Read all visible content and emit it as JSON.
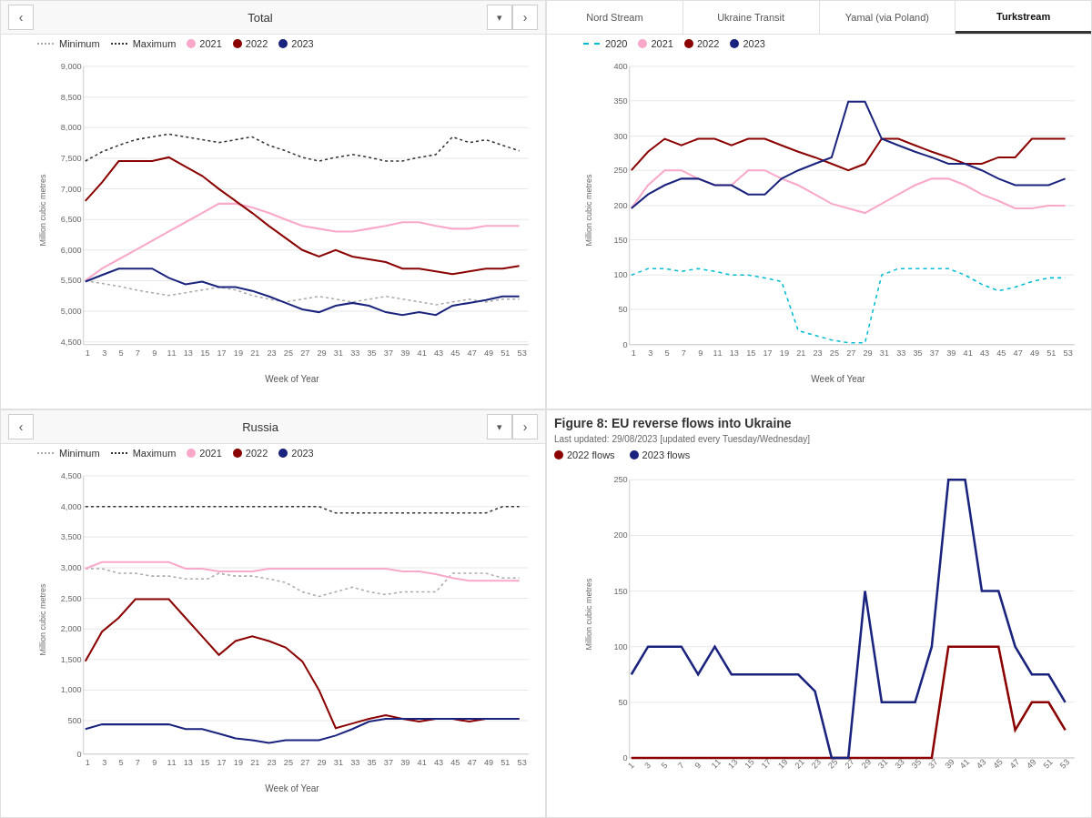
{
  "panels": {
    "top_left": {
      "title": "Total",
      "nav_prev": "‹",
      "nav_next": "›",
      "dropdown": "▾",
      "legend": [
        {
          "label": "Minimum",
          "color": "#aaa",
          "type": "dot-dashed"
        },
        {
          "label": "Maximum",
          "color": "#333",
          "type": "dot-dashed"
        },
        {
          "label": "2021",
          "color": "#f9a8c9",
          "type": "dot"
        },
        {
          "label": "2022",
          "color": "#8b0000",
          "type": "dot"
        },
        {
          "label": "2023",
          "color": "#1a237e",
          "type": "dot"
        }
      ],
      "y_label": "Million cubic metres",
      "x_label": "Week of Year",
      "y_ticks": [
        "9,000",
        "8,500",
        "8,000",
        "7,500",
        "7,000",
        "6,500",
        "6,000",
        "5,500",
        "5,000",
        "4,500"
      ],
      "x_ticks": [
        "1",
        "3",
        "5",
        "7",
        "9",
        "11",
        "13",
        "15",
        "17",
        "19",
        "21",
        "23",
        "25",
        "27",
        "29",
        "31",
        "33",
        "35",
        "37",
        "39",
        "41",
        "43",
        "45",
        "47",
        "49",
        "51",
        "53"
      ]
    },
    "top_right": {
      "tabs": [
        "Nord Stream",
        "Ukraine Transit",
        "Yamal (via Poland)",
        "Turkstream"
      ],
      "active_tab": "Turkstream",
      "legend": [
        {
          "label": "2020",
          "color": "#00bcd4",
          "type": "dot-dashed"
        },
        {
          "label": "2021",
          "color": "#f9a8c9",
          "type": "dot"
        },
        {
          "label": "2022",
          "color": "#8b0000",
          "type": "dot"
        },
        {
          "label": "2023",
          "color": "#1a237e",
          "type": "dot"
        }
      ],
      "y_label": "Million cubic metres",
      "x_label": "Week of Year",
      "y_ticks": [
        "400",
        "350",
        "300",
        "250",
        "200",
        "150",
        "100",
        "50",
        "0"
      ],
      "x_ticks": [
        "1",
        "3",
        "5",
        "7",
        "9",
        "11",
        "13",
        "15",
        "17",
        "19",
        "21",
        "23",
        "25",
        "27",
        "29",
        "31",
        "33",
        "35",
        "37",
        "39",
        "41",
        "43",
        "45",
        "47",
        "49",
        "51",
        "53"
      ]
    },
    "bottom_left": {
      "title": "Russia",
      "nav_prev": "‹",
      "nav_next": "›",
      "dropdown": "▾",
      "legend": [
        {
          "label": "Minimum",
          "color": "#aaa",
          "type": "dot-dashed"
        },
        {
          "label": "Maximum",
          "color": "#333",
          "type": "dot-dashed"
        },
        {
          "label": "2021",
          "color": "#f9a8c9",
          "type": "dot"
        },
        {
          "label": "2022",
          "color": "#8b0000",
          "type": "dot"
        },
        {
          "label": "2023",
          "color": "#1a237e",
          "type": "dot"
        }
      ],
      "y_label": "Million cubic metres",
      "x_label": "Week of Year",
      "y_ticks": [
        "4,500",
        "4,000",
        "3,500",
        "3,000",
        "2,500",
        "2,000",
        "1,500",
        "1,000",
        "500",
        "0"
      ],
      "x_ticks": [
        "1",
        "3",
        "5",
        "7",
        "9",
        "11",
        "13",
        "15",
        "17",
        "19",
        "21",
        "23",
        "25",
        "27",
        "29",
        "31",
        "33",
        "35",
        "37",
        "39",
        "41",
        "43",
        "45",
        "47",
        "49",
        "51",
        "53"
      ]
    },
    "bottom_right": {
      "figure_title": "Figure 8: EU reverse flows into Ukraine",
      "last_updated": "Last updated: 29/08/2023 [updated every Tuesday/Wednesday]",
      "legend": [
        {
          "label": "2022 flows",
          "color": "#8b0000",
          "type": "dot"
        },
        {
          "label": "2023 flows",
          "color": "#1a237e",
          "type": "dot"
        }
      ],
      "y_label": "Million cubic metres",
      "x_label": "Week of Year",
      "y_ticks": [
        "250",
        "200",
        "150",
        "100",
        "50",
        "0"
      ],
      "x_ticks": [
        "1",
        "3",
        "5",
        "7",
        "9",
        "11",
        "13",
        "15",
        "17",
        "19",
        "21",
        "23",
        "25",
        "27",
        "29",
        "31",
        "33",
        "35",
        "37",
        "39",
        "41",
        "43",
        "45",
        "47",
        "49",
        "51",
        "53"
      ]
    }
  }
}
